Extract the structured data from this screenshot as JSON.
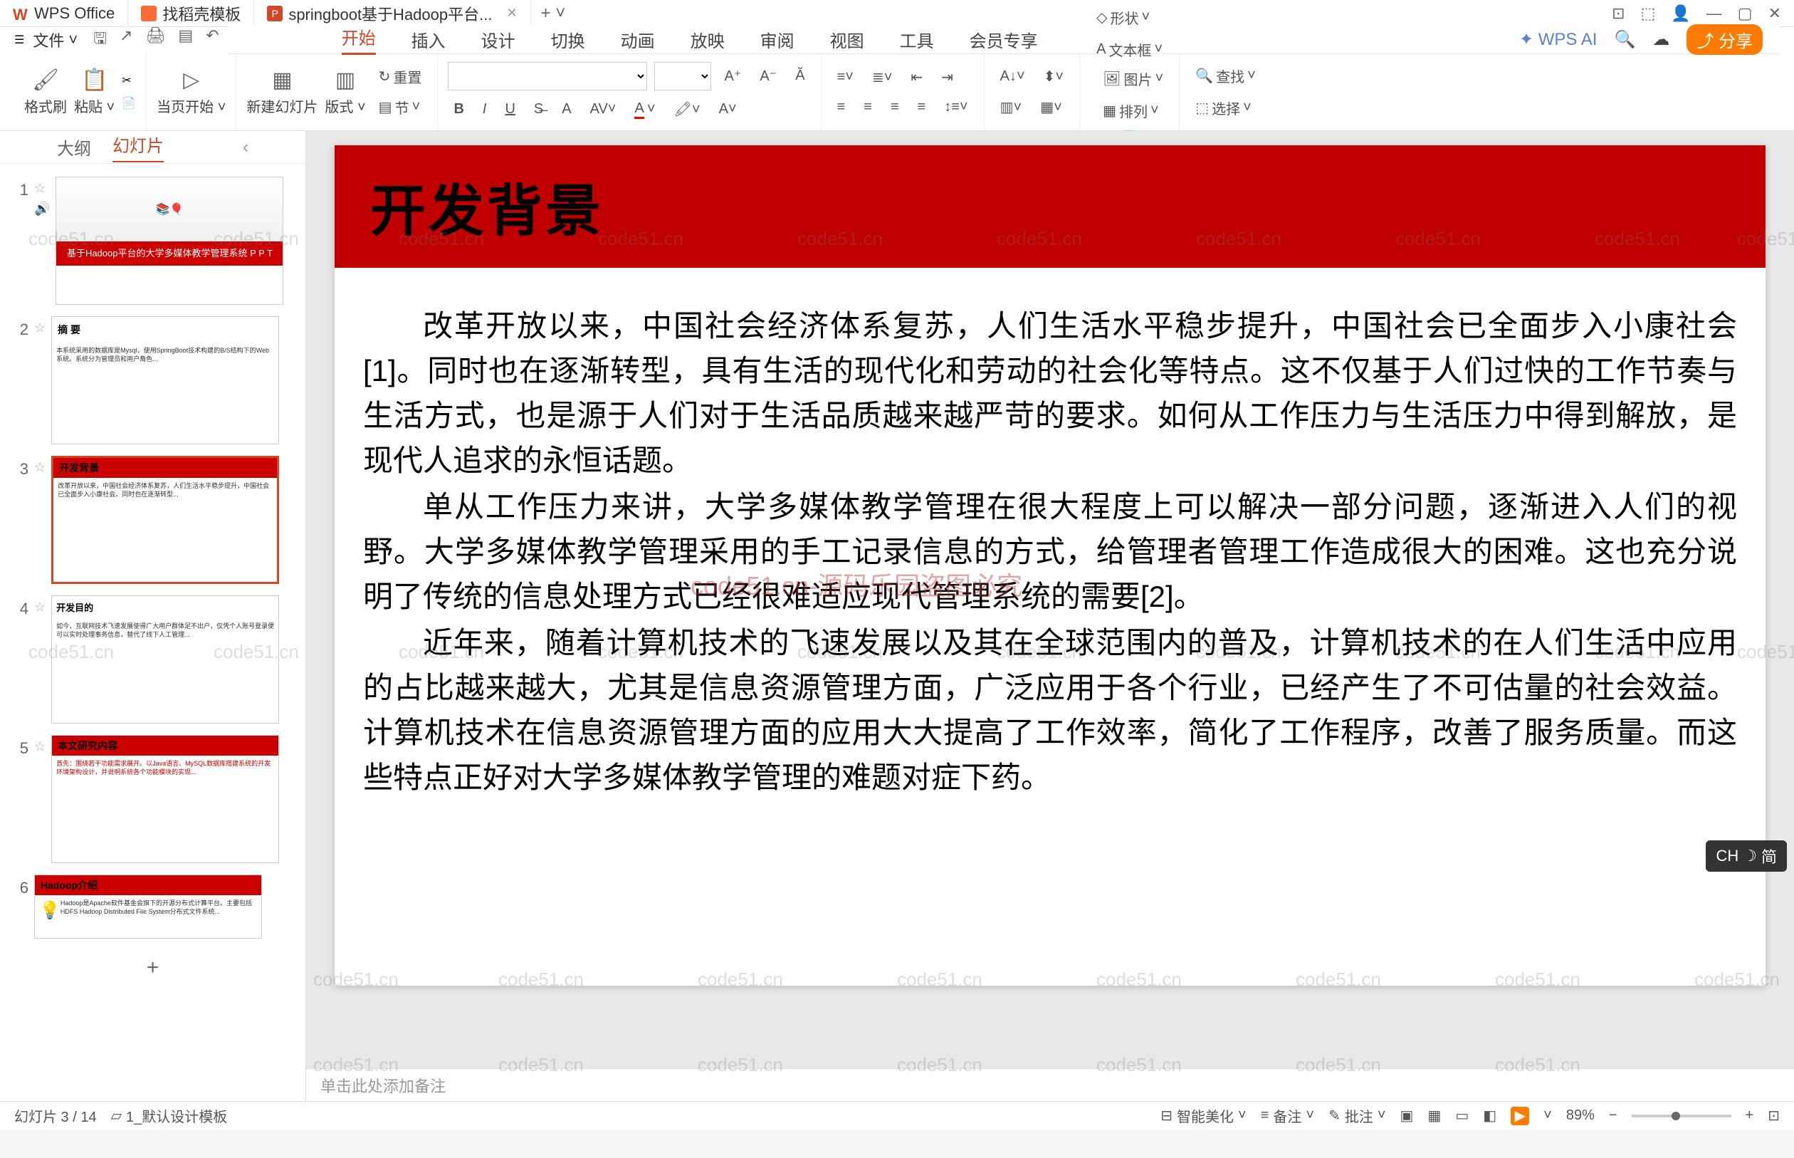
{
  "titlebar": {
    "tab1": "WPS Office",
    "tab2": "找稻壳模板",
    "tab3": "springboot基于Hadoop平台...",
    "newtab": "+"
  },
  "menubar": {
    "file": "文件"
  },
  "ribbon_tabs": {
    "start": "开始",
    "insert": "插入",
    "design": "设计",
    "transition": "切换",
    "animation": "动画",
    "show": "放映",
    "review": "审阅",
    "view": "视图",
    "tools": "工具",
    "member": "会员专享",
    "wpsai": "WPS AI"
  },
  "ribbon": {
    "format_painter": "格式刷",
    "paste": "粘贴",
    "from_current": "当页开始",
    "new_slide": "新建幻灯片",
    "layout": "版式",
    "section": "节",
    "reset": "重置",
    "shape": "形状",
    "image": "图片",
    "textbox": "文本框",
    "arrange": "排列",
    "find": "查找",
    "select": "选择"
  },
  "sidepanel": {
    "outline": "大纲",
    "slides": "幻灯片",
    "thumbs": {
      "t1_title": "基于Hadoop平台的大学多媒体教学管理系统 P P T",
      "t2_title": "摘 要",
      "t3_title": "开发背景",
      "t4_title": "开发目的",
      "t5_title": "本文研究内容",
      "t6_title": "Hadoop介绍"
    }
  },
  "slide": {
    "title": "开发背景",
    "p1": "改革开放以来，中国社会经济体系复苏，人们生活水平稳步提升，中国社会已全面步入小康社会[1]。同时也在逐渐转型，具有生活的现代化和劳动的社会化等特点。这不仅基于人们过快的工作节奏与生活方式，也是源于人们对于生活品质越来越严苛的要求。如何从工作压力与生活压力中得到解放，是现代人追求的永恒话题。",
    "p2": "单从工作压力来讲，大学多媒体教学管理在很大程度上可以解决一部分问题，逐渐进入人们的视野。大学多媒体教学管理采用的手工记录信息的方式，给管理者管理工作造成很大的困难。这也充分说明了传统的信息处理方式已经很难适应现代管理系统的需要[2]。",
    "p3": "近年来，随着计算机技术的飞速发展以及其在全球范围内的普及，计算机技术的在人们生活中应用的占比越来越大，尤其是信息资源管理方面，广泛应用于各个行业，已经产生了不可估量的社会效益。计算机技术在信息资源管理方面的应用大大提高了工作效率，简化了工作程序，改善了服务质量。而这些特点正好对大学多媒体教学管理的难题对症下药。"
  },
  "watermark_center": "code51.cn-源码乐园盗图必究",
  "watermark_tile": "code51.cn",
  "notes": {
    "placeholder": "单击此处添加备注"
  },
  "statusbar": {
    "slide_pos": "幻灯片 3 / 14",
    "template": "1_默认设计模板",
    "beautify": "智能美化",
    "notes_btn": "备注",
    "comments": "批注",
    "zoom": "89%"
  },
  "ime": {
    "label": "CH",
    "mode": "简"
  }
}
